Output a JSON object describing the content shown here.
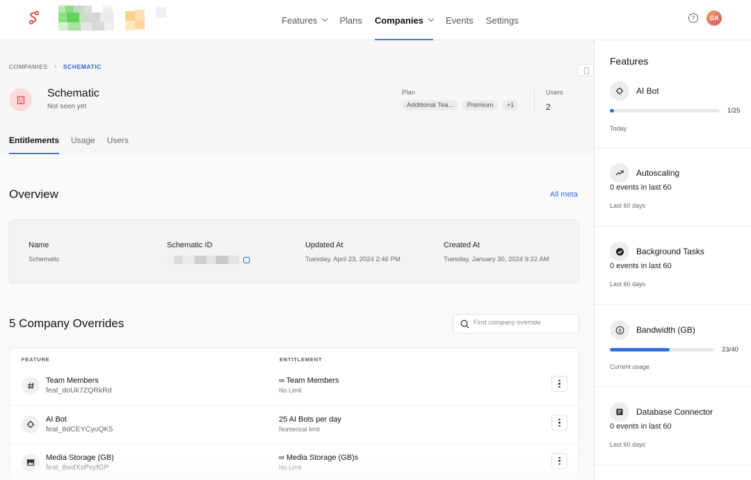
{
  "nav": {
    "items": [
      {
        "label": "Features",
        "has_menu": true
      },
      {
        "label": "Plans",
        "has_menu": false
      },
      {
        "label": "Companies",
        "has_menu": true
      },
      {
        "label": "Events",
        "has_menu": false
      },
      {
        "label": "Settings",
        "has_menu": false
      }
    ],
    "active": "Companies",
    "help_icon": "help-circle-icon",
    "avatar_initials": "GX"
  },
  "breadcrumb": {
    "parent": "COMPANIES",
    "current": "SCHEMATIC"
  },
  "company": {
    "name": "Schematic",
    "status": "Not seen yet",
    "plan_label": "Plan",
    "plans": [
      "Additional Tea...",
      "Premium",
      "+1"
    ],
    "users_label": "Users",
    "users_count": "2"
  },
  "tabs": [
    "Entitlements",
    "Usage",
    "Users"
  ],
  "active_tab": "Entitlements",
  "overview": {
    "title": "Overview",
    "link": "All meta",
    "fields": [
      {
        "label": "Name",
        "value": "Schematic"
      },
      {
        "label": "Schematic ID",
        "value": ""
      },
      {
        "label": "Updated At",
        "value": "Tuesday, April 23, 2024 2:46 PM"
      },
      {
        "label": "Created At",
        "value": "Tuesday, January 30, 2024 9:22 AM"
      }
    ]
  },
  "overrides": {
    "title": "5 Company Overrides",
    "search_placeholder": "Find company override",
    "columns": [
      "FEATURE",
      "ENTITLEMENT"
    ],
    "rows": [
      {
        "icon": "hash-icon",
        "name": "Team Members",
        "key": "feat_doUk7ZQRkRd",
        "entitlement": "∞ Team Members",
        "entitlement_type": "No Limit"
      },
      {
        "icon": "bot-icon",
        "name": "AI Bot",
        "key": "feat_8dCEYCyoQK5",
        "entitlement": "25 AI Bots per day",
        "entitlement_type": "Numerical limit"
      },
      {
        "icon": "image-icon",
        "name": "Media Storage (GB)",
        "key": "feat_8wdXsPxyfGP",
        "entitlement": "∞ Media Storage (GB)s",
        "entitlement_type": "No Limit"
      }
    ]
  },
  "features_panel": {
    "title": "Features",
    "cards": [
      {
        "name": "AI Bot",
        "icon": "bot-icon",
        "usage_fraction": 0.04,
        "count": "1/25",
        "events": "",
        "period": "Today"
      },
      {
        "name": "Autoscaling",
        "icon": "trend-up-icon",
        "usage_fraction": null,
        "count": "",
        "events": "0 events in last 60",
        "period": "Last 60 days"
      },
      {
        "name": "Background Tasks",
        "icon": "check-circle-icon",
        "usage_fraction": null,
        "count": "",
        "events": "0 events in last 60",
        "period": "Last 60 days"
      },
      {
        "name": "Bandwidth (GB)",
        "icon": "dollar-circle-icon",
        "usage_fraction": 0.575,
        "count": "23/40",
        "events": "",
        "period": "Current usage"
      },
      {
        "name": "Database Connector",
        "icon": "database-icon",
        "usage_fraction": null,
        "count": "",
        "events": "0 events in last 60",
        "period": "Last 60 days"
      }
    ]
  },
  "colors": {
    "accent": "#4b6ee8",
    "link": "#2f6de0",
    "company_icon_bg": "#fbdada",
    "company_icon_fg": "#e0505a"
  }
}
